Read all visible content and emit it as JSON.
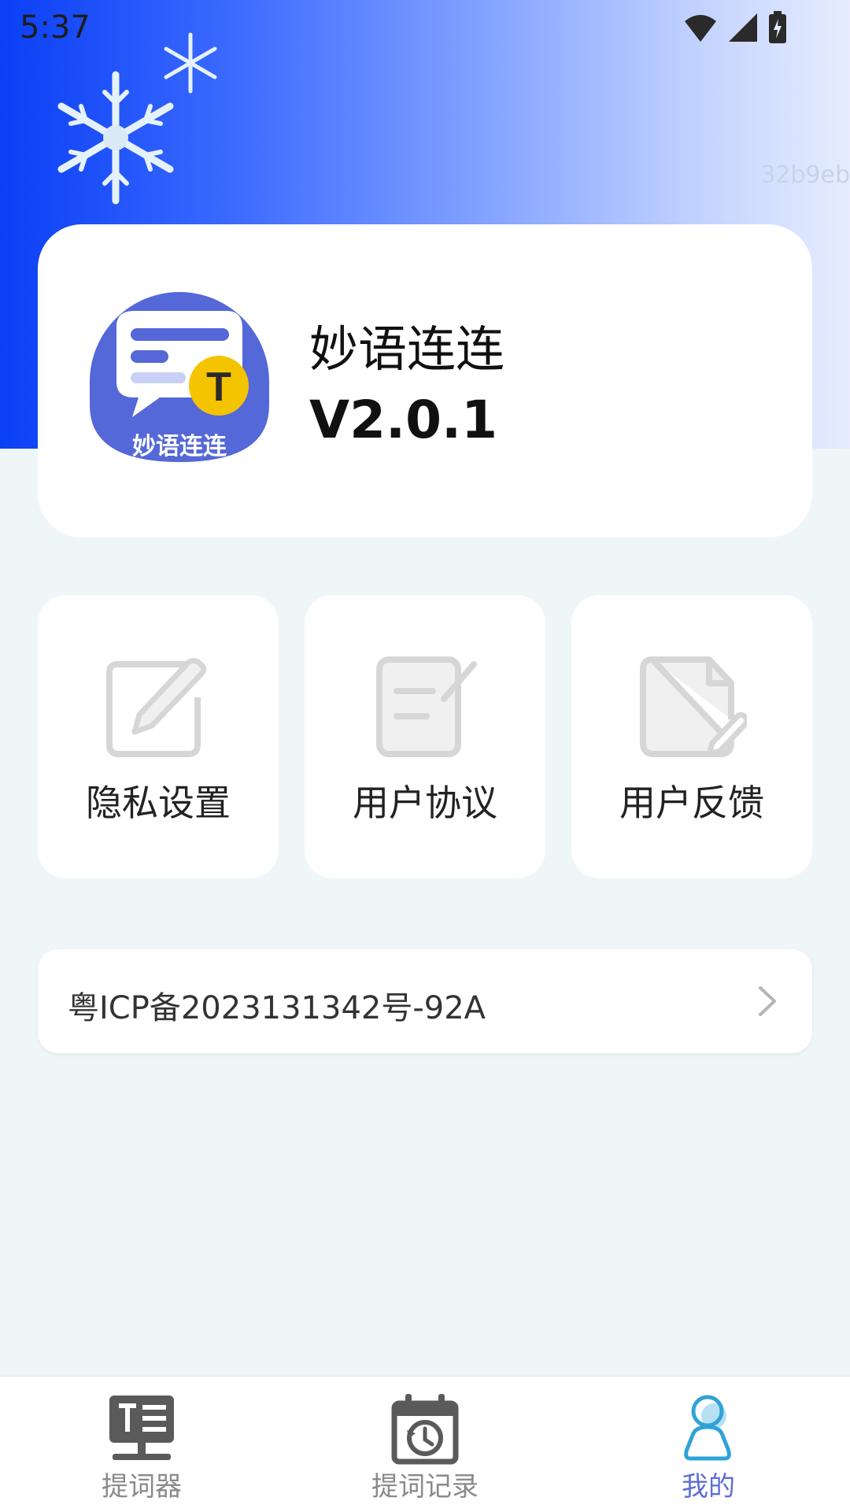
{
  "status_bar": {
    "time": "5:37"
  },
  "build_hash": "32b9eb",
  "app": {
    "logo_text": "妙语连连",
    "logo_badge": "T",
    "name": "妙语连连",
    "version": "V2.0.1"
  },
  "menu": [
    {
      "label": "隐私设置",
      "icon": "edit-icon"
    },
    {
      "label": "用户协议",
      "icon": "agreement-icon"
    },
    {
      "label": "用户反馈",
      "icon": "feedback-icon"
    }
  ],
  "icp": {
    "text": "粤ICP备2023131342号-92A"
  },
  "nav": [
    {
      "label": "提词器",
      "icon": "teleprompter-icon",
      "active": false
    },
    {
      "label": "提词记录",
      "icon": "history-calendar-icon",
      "active": false
    },
    {
      "label": "我的",
      "icon": "profile-icon",
      "active": true
    }
  ],
  "colors": {
    "accent": "#5b6fd6",
    "header_start": "#0a3ff5",
    "header_end": "#e6edff",
    "background": "#eef6f8"
  }
}
